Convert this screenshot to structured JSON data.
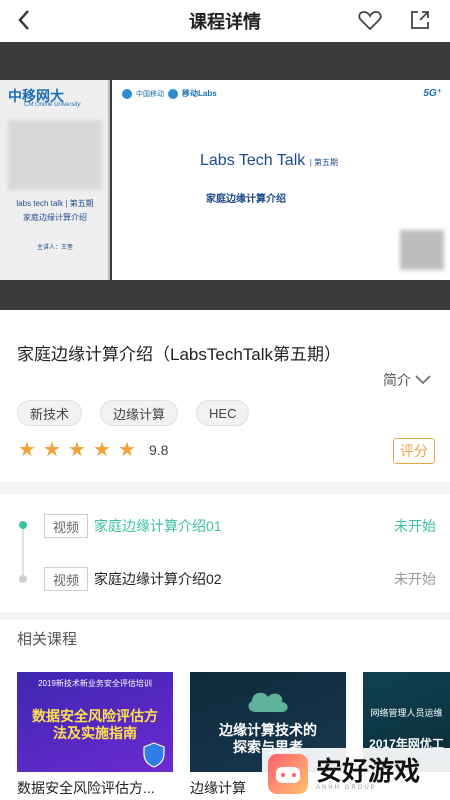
{
  "header": {
    "title": "课程详情",
    "back_icon": "chevron-left-icon",
    "favorite_icon": "heart-icon",
    "share_icon": "share-icon"
  },
  "player": {
    "left_slide": {
      "logo": "中移网大",
      "logo_sub": "CM Online University",
      "line1": "labs tech talk | 第五期",
      "line2": "家庭边缘计算介绍",
      "line3": "主讲人：王奎"
    },
    "main_slide": {
      "brand1": "中国移动",
      "brand1_sub": "China Mobile",
      "brand2": "移动Labs",
      "badge": "5G⁺",
      "title": "Labs Tech Talk",
      "issue": "| 第五期",
      "subtitle": "家庭边缘计算介绍"
    }
  },
  "course": {
    "title": "家庭边缘计算介绍（LabsTechTalk第五期）",
    "intro_label": "简介",
    "tags": [
      "新技术",
      "边缘计算",
      "HEC"
    ],
    "rating": 9.8,
    "rating_display": "9.8",
    "stars": 5,
    "rate_button": "评分"
  },
  "lessons": [
    {
      "kind": "视频",
      "name": "家庭边缘计算介绍01",
      "status": "未开始",
      "active": true
    },
    {
      "kind": "视频",
      "name": "家庭边缘计算介绍02",
      "status": "未开始",
      "active": false
    }
  ],
  "related": {
    "title": "相关课程",
    "cards": [
      {
        "caption": "数据安全风险评估方...",
        "thumb_top": "2019新技术新业务安全评估培训",
        "thumb_main": "数据安全风险评估方法及实施指南"
      },
      {
        "caption": "边缘计算",
        "thumb_main": "边缘计算技术的探索与思考"
      },
      {
        "caption": "",
        "thumb_top": "网络管理人员运维",
        "thumb_main": "2017年网优工"
      }
    ]
  },
  "watermark": {
    "text": "安好游戏",
    "sub": "ANHH GROUP"
  },
  "colors": {
    "accent": "#3cc3a0",
    "orange": "#e8a64d",
    "star": "#f1a03a"
  }
}
